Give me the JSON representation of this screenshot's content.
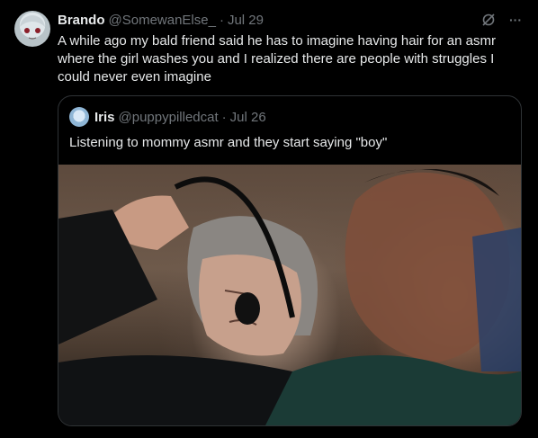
{
  "tweet": {
    "name": "Brando",
    "handle": "@SomewanElse_",
    "dot": "·",
    "date": "Jul 29",
    "text": "A while ago my bald friend said he has to imagine having hair for an asmr where the girl washes you and I realized there are people with struggles I could never even imagine"
  },
  "quote": {
    "name": "Iris",
    "handle": "@puppypilledcat",
    "dot": "·",
    "date": "Jul 26",
    "text": "Listening to mommy asmr and they start saying \"boy\""
  },
  "icons": {
    "grok": "grok-icon",
    "more": "more-icon",
    "more_glyph": "···"
  },
  "colors": {
    "background": "#000000",
    "text": "#e7e9ea",
    "muted": "#71767b",
    "border": "#2f3336"
  }
}
